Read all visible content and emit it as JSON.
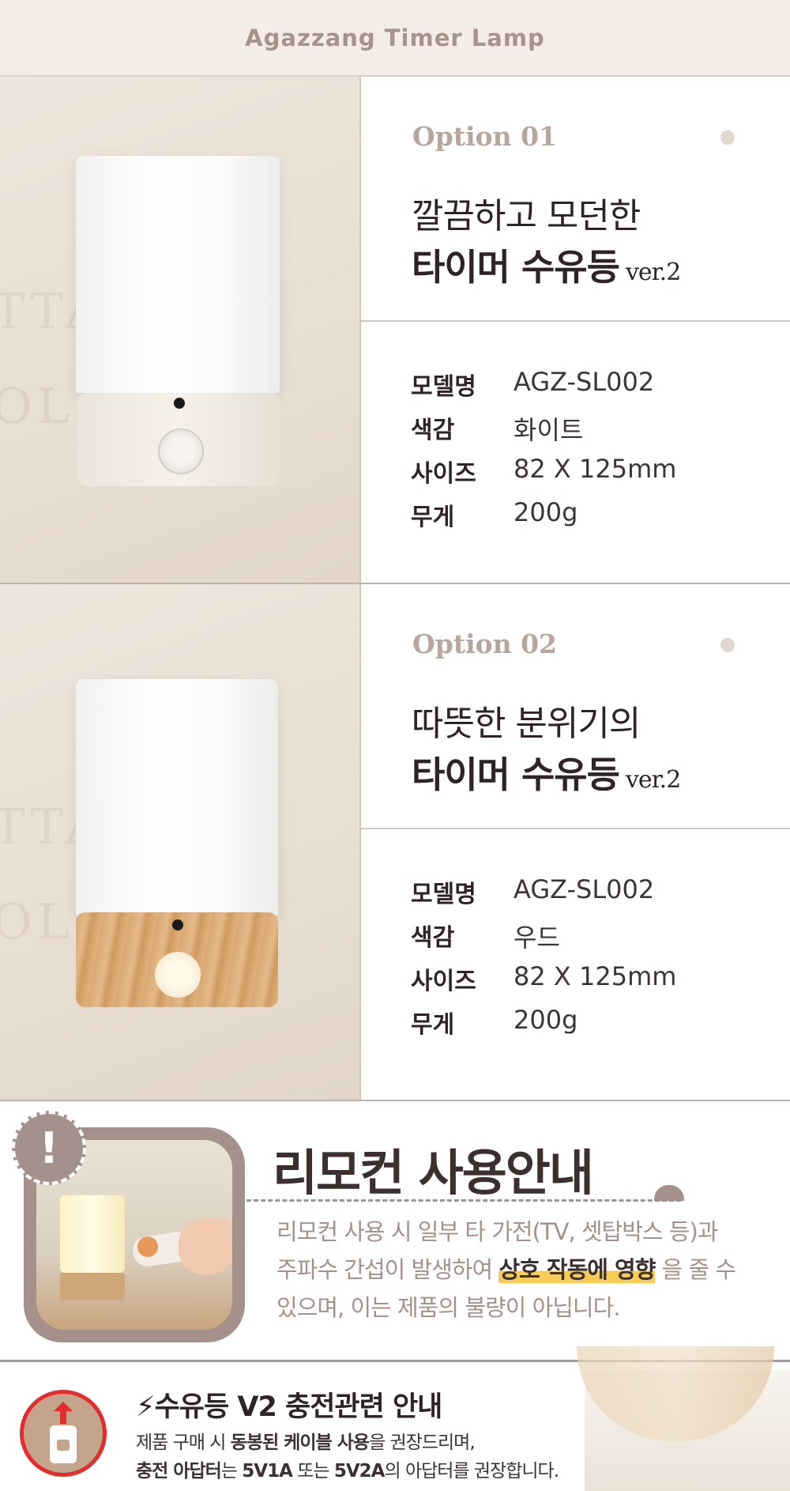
{
  "header": {
    "title": "Agazzang Timer Lamp"
  },
  "options": [
    {
      "label": "Option 01",
      "line1": "깔끔하고 모던한",
      "line2": "타이머 수유등",
      "version": "ver.2",
      "specs": [
        {
          "key": "모델명",
          "value": "AGZ-SL002"
        },
        {
          "key": "색감",
          "value": "화이트"
        },
        {
          "key": "사이즈",
          "value": "82 X 125mm"
        },
        {
          "key": "무게",
          "value": "200g"
        }
      ]
    },
    {
      "label": "Option 02",
      "line1": "따뜻한 분위기의",
      "line2": "타이머 수유등",
      "version": "ver.2",
      "specs": [
        {
          "key": "모델명",
          "value": "AGZ-SL002"
        },
        {
          "key": "색감",
          "value": "우드"
        },
        {
          "key": "사이즈",
          "value": "82 X 125mm"
        },
        {
          "key": "무게",
          "value": "200g"
        }
      ]
    }
  ],
  "remote": {
    "title": "리모컨 사용안내",
    "badge": "!",
    "line1": "리모컨 사용 시 일부 타 가전(TV, 셋탑박스 등)과",
    "line2_pre": "주파수 간섭이 발생하여",
    "line2_highlight": "상호 작동에 영향",
    "line2_post": "을 줄 수",
    "line3": "있으며, 이는 제품의 불량이 아닙니다."
  },
  "charge": {
    "title": "수유등 V2 충전관련 안내",
    "text1_pre": "제품 구매 시",
    "text1_bold": "동봉된 케이블 사용",
    "text1_post": "을 권장드리며,",
    "text2_bold1": "충전 아답터",
    "text2_mid1": "는",
    "text2_bold2": "5V1A",
    "text2_mid2": "또는",
    "text2_bold3": "5V2A",
    "text2_post": "의 아답터를 권장합니다."
  },
  "colors": {
    "accent": "#a4918c",
    "highlight": "#f6cc57",
    "text": "#2e2426",
    "warning_ring": "#e12d2d"
  }
}
